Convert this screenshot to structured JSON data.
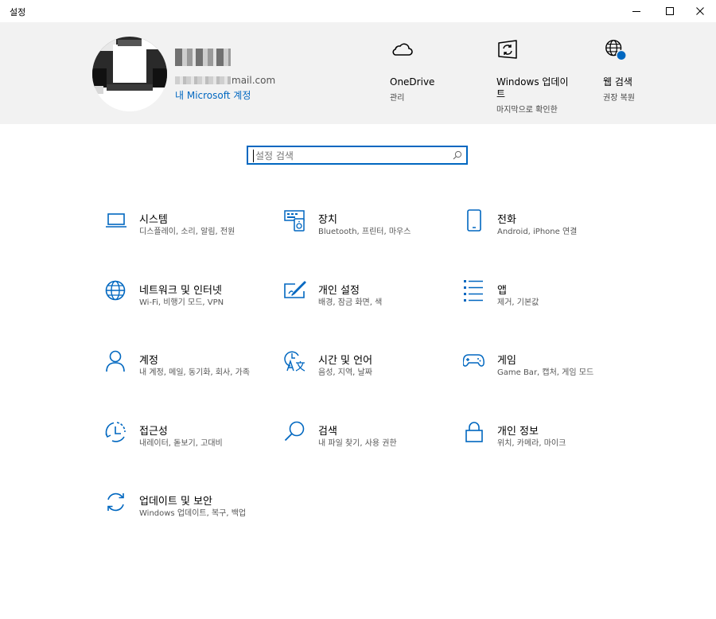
{
  "window": {
    "title": "설정"
  },
  "account": {
    "email_suffix": "mail.com",
    "link": "내 Microsoft 계정"
  },
  "header_items": [
    {
      "icon": "onedrive-cloud-icon",
      "title": "OneDrive",
      "subtitle": "관리"
    },
    {
      "icon": "windows-update-icon",
      "title": "Windows 업데이트",
      "subtitle": "마지막으로 확인한"
    },
    {
      "icon": "web-search-globe-icon",
      "title": "웹 검색",
      "subtitle": "권장 복원"
    }
  ],
  "search": {
    "placeholder": "설정 검색",
    "value": ""
  },
  "categories": [
    {
      "name": "시스템",
      "desc": "디스플레이, 소리, 알림, 전원",
      "icon": "laptop-icon"
    },
    {
      "name": "장치",
      "desc": "Bluetooth, 프린터, 마우스",
      "icon": "devices-icon"
    },
    {
      "name": "전화",
      "desc": "Android, iPhone 연결",
      "icon": "phone-icon"
    },
    {
      "name": "네트워크 및 인터넷",
      "desc": "Wi-Fi, 비행기 모드, VPN",
      "icon": "globe-icon"
    },
    {
      "name": "개인 설정",
      "desc": "배경, 잠금 화면, 색",
      "icon": "personalization-icon"
    },
    {
      "name": "앱",
      "desc": "제거, 기본값",
      "icon": "apps-list-icon"
    },
    {
      "name": "계정",
      "desc": "내 계정, 메일, 동기화, 회사, 가족",
      "icon": "person-icon"
    },
    {
      "name": "시간 및 언어",
      "desc": "음성, 지역, 날짜",
      "icon": "time-language-icon"
    },
    {
      "name": "게임",
      "desc": "Game Bar, 캡처, 게임 모드",
      "icon": "gamepad-icon"
    },
    {
      "name": "접근성",
      "desc": "내레이터, 돋보기, 고대비",
      "icon": "ease-of-access-icon"
    },
    {
      "name": "검색",
      "desc": "내 파일 찾기, 사용 권한",
      "icon": "search-magnifier-icon"
    },
    {
      "name": "개인 정보",
      "desc": "위치, 카메라, 마이크",
      "icon": "lock-icon"
    },
    {
      "name": "업데이트 및 보안",
      "desc": "Windows 업데이트, 복구, 백업",
      "icon": "sync-icon"
    }
  ],
  "colors": {
    "accent": "#0067c0",
    "header_bg": "#f2f2f2"
  }
}
